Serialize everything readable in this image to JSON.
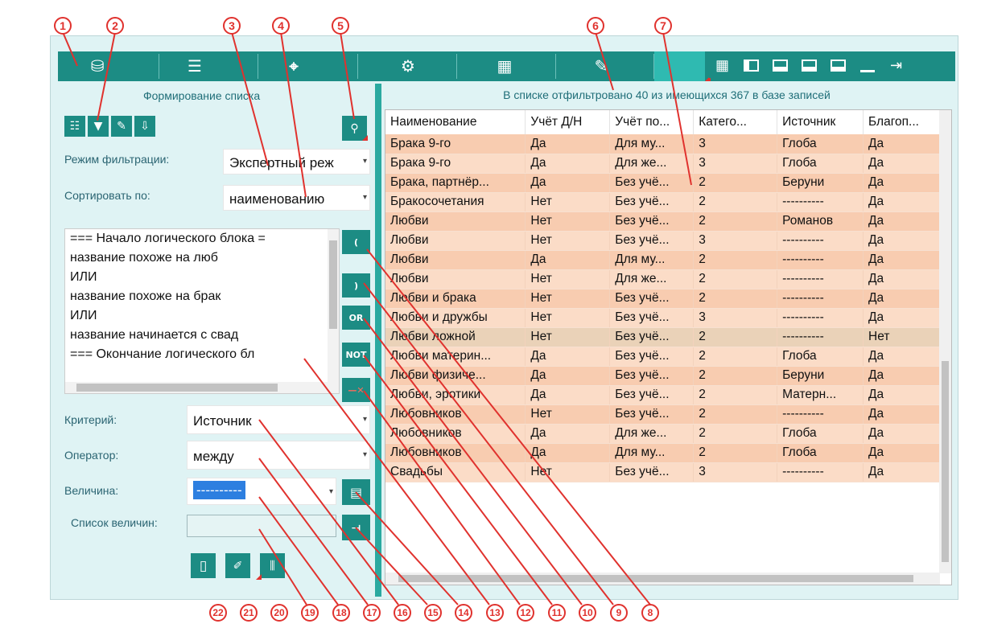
{
  "toolbar": {
    "tabs": [
      "database",
      "list",
      "crosshair",
      "settings",
      "calculator",
      "pen"
    ],
    "window_buttons": [
      "grid",
      "left-panel",
      "bottom-panel",
      "right-panel",
      "top-panel",
      "minimize",
      "exit"
    ]
  },
  "left": {
    "title": "Формирование списка",
    "filter_mode_label": "Режим фильтрации:",
    "filter_mode_value": "Экспертный реж",
    "sort_label": "Сортировать по:",
    "sort_value": "наименованию",
    "editor_lines": [
      "=== Начало логического блока =",
      "название похоже на люб",
      "ИЛИ",
      "название похоже на брак",
      "ИЛИ",
      "название начинается с свад",
      "=== Окончание логического бл"
    ],
    "logic_buttons": [
      "(",
      ")",
      "OR",
      "NOT",
      "—✕"
    ],
    "criterion_label": "Критерий:",
    "criterion_value": "Источник",
    "operator_label": "Оператор:",
    "operator_value": "между",
    "value_label": "Величина:",
    "value_value": "----------",
    "value_list_label": "Список величин:"
  },
  "right": {
    "info": "В списке отфильтровано 40 из имеющихся 367 в базе записей",
    "columns": [
      "Наименование",
      "Учёт Д/Н",
      "Учёт по...",
      "Катего...",
      "Источник",
      "Благоп..."
    ],
    "rows": [
      [
        "Брака 9-го",
        "Да",
        "Для му...",
        "3",
        "Глоба",
        "Да"
      ],
      [
        "Брака 9-го",
        "Да",
        "Для же...",
        "3",
        "Глоба",
        "Да"
      ],
      [
        "Брака, партнёр...",
        "Да",
        "Без учё...",
        "2",
        "Беруни",
        "Да"
      ],
      [
        "Бракосочетания",
        "Нет",
        "Без учё...",
        "2",
        "----------",
        "Да"
      ],
      [
        "Любви",
        "Нет",
        "Без учё...",
        "2",
        "Романов",
        "Да"
      ],
      [
        "Любви",
        "Нет",
        "Без учё...",
        "3",
        "----------",
        "Да"
      ],
      [
        "Любви",
        "Да",
        "Для му...",
        "2",
        "----------",
        "Да"
      ],
      [
        "Любви",
        "Нет",
        "Для же...",
        "2",
        "----------",
        "Да"
      ],
      [
        "Любви и брака",
        "Нет",
        "Без учё...",
        "2",
        "----------",
        "Да"
      ],
      [
        "Любви и дружбы",
        "Нет",
        "Без учё...",
        "3",
        "----------",
        "Да"
      ],
      [
        "Любви ложной",
        "Нет",
        "Без учё...",
        "2",
        "----------",
        "Нет"
      ],
      [
        "Любви материн...",
        "Да",
        "Без учё...",
        "2",
        "Глоба",
        "Да"
      ],
      [
        "Любви физиче...",
        "Да",
        "Без учё...",
        "2",
        "Беруни",
        "Да"
      ],
      [
        "Любви, эротики",
        "Да",
        "Без учё...",
        "2",
        "Матерн...",
        "Да"
      ],
      [
        "Любовников",
        "Нет",
        "Без учё...",
        "2",
        "----------",
        "Да"
      ],
      [
        "Любовников",
        "Да",
        "Для же...",
        "2",
        "Глоба",
        "Да"
      ],
      [
        "Любовников",
        "Да",
        "Для му...",
        "2",
        "Глоба",
        "Да"
      ],
      [
        "Свадьбы",
        "Нет",
        "Без учё...",
        "3",
        "----------",
        "Да"
      ]
    ]
  },
  "callouts": [
    "1",
    "2",
    "3",
    "4",
    "5",
    "6",
    "7",
    "8",
    "9",
    "10",
    "11",
    "12",
    "13",
    "14",
    "15",
    "16",
    "17",
    "18",
    "19",
    "20",
    "21",
    "22"
  ]
}
